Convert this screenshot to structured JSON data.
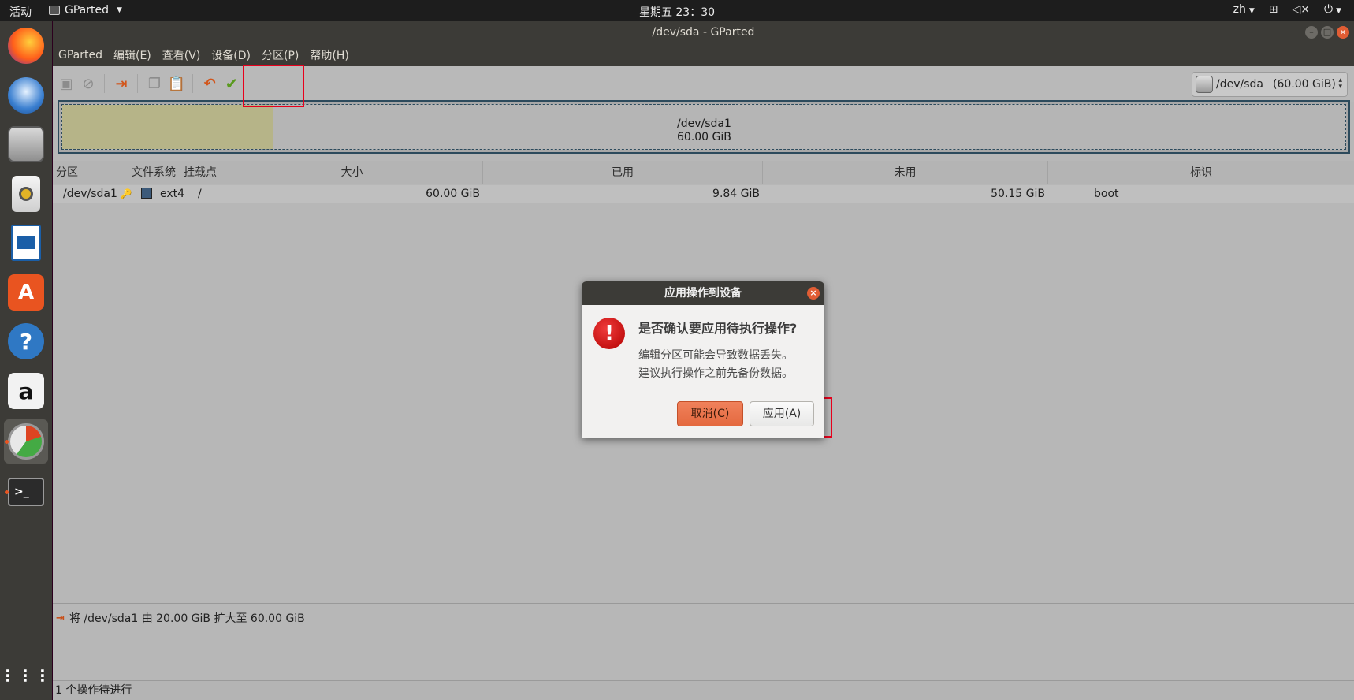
{
  "topbar": {
    "activities": "活动",
    "app_name": "GParted",
    "clock": "星期五 23：30",
    "lang": "zh"
  },
  "window": {
    "title": "/dev/sda - GParted",
    "menu": [
      "GParted",
      "编辑(E)",
      "查看(V)",
      "设备(D)",
      "分区(P)",
      "帮助(H)"
    ]
  },
  "toolbar": {
    "device_path": "/dev/sda",
    "device_size": "(60.00 GiB)"
  },
  "graph": {
    "partition": "/dev/sda1",
    "size": "60.00 GiB",
    "used_fraction": 0.164
  },
  "table": {
    "headers": [
      "分区",
      "文件系统",
      "挂载点",
      "大小",
      "已用",
      "未用",
      "标识"
    ],
    "rows": [
      {
        "partition": "/dev/sda1",
        "filesystem": "ext4",
        "mountpoint": "/",
        "size": "60.00 GiB",
        "used": "9.84 GiB",
        "unused": "50.15 GiB",
        "flags": "boot"
      }
    ]
  },
  "operations": {
    "pending": [
      "将 /dev/sda1 由 20.00 GiB 扩大至 60.00 GiB"
    ],
    "status": "1 个操作待进行"
  },
  "dialog": {
    "title": "应用操作到设备",
    "heading": "是否确认要应用待执行操作?",
    "line1": "编辑分区可能会导致数据丢失。",
    "line2": "建议执行操作之前先备份数据。",
    "cancel": "取消(C)",
    "apply": "应用(A)"
  },
  "colors": {
    "accent": "#e95420",
    "highlight": "#e8001c",
    "fs_ext4": "#3c5a7a"
  }
}
